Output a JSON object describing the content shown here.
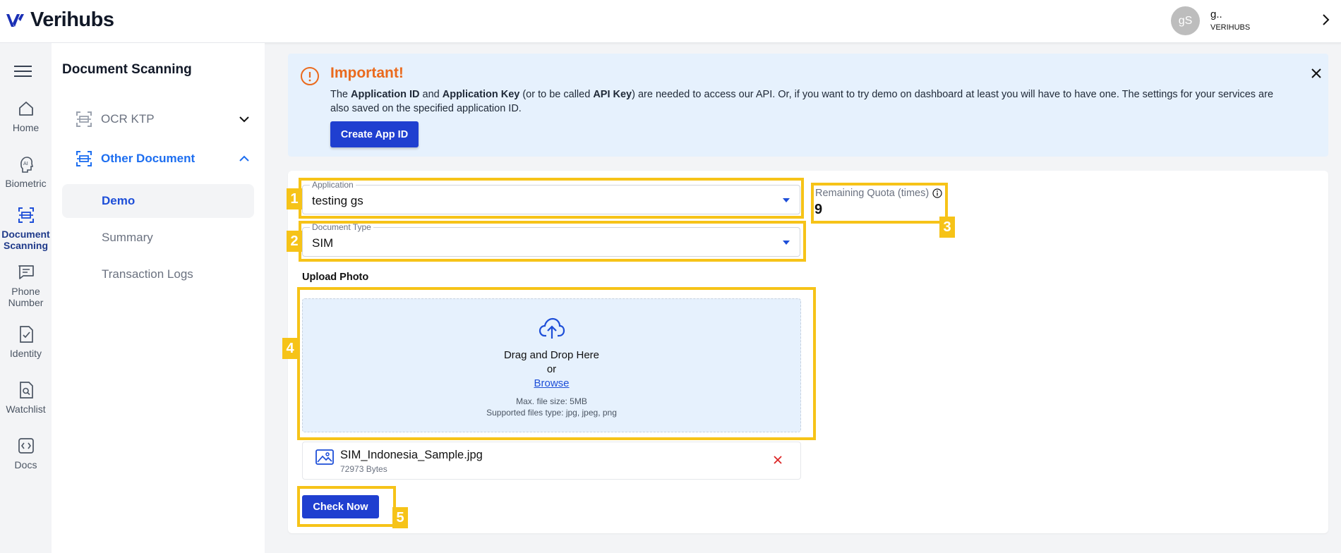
{
  "header": {
    "brand": "Verihubs",
    "user_initials": "gS",
    "user_name": "g..",
    "user_org": "VERIHUBS"
  },
  "rail": {
    "items": [
      {
        "label": "Home",
        "icon": "home-icon"
      },
      {
        "label": "Biometric",
        "icon": "ai-face-icon"
      },
      {
        "label": "Document Scanning",
        "icon": "scan-icon"
      },
      {
        "label": "Phone Number",
        "icon": "chat-icon"
      },
      {
        "label": "Identity",
        "icon": "document-check-icon"
      },
      {
        "label": "Watchlist",
        "icon": "document-search-icon"
      },
      {
        "label": "Docs",
        "icon": "code-icon"
      }
    ],
    "active": "Document Scanning"
  },
  "sidebar": {
    "title": "Document Scanning",
    "groups": [
      {
        "label": "OCR KTP",
        "expanded": false
      },
      {
        "label": "Other Document",
        "expanded": true
      }
    ],
    "sub_items": [
      "Demo",
      "Summary",
      "Transaction Logs"
    ],
    "active_sub": "Demo"
  },
  "alert": {
    "title": "Important!",
    "body_1": "The ",
    "bold_1": "Application ID",
    "body_2": " and ",
    "bold_2": "Application Key",
    "body_3": " (or to be called ",
    "bold_3": "API Key",
    "body_4": ") are needed to access our API. Or, if you want to try demo on dashboard at least you will have to have one. The settings for your services are also saved on the specified application ID.",
    "button": "Create App ID"
  },
  "form": {
    "application_label": "Application",
    "application_value": "testing gs",
    "document_type_label": "Document Type",
    "document_type_value": "SIM",
    "quota_label": "Remaining Quota (times)",
    "quota_value": "9",
    "upload_title": "Upload Photo",
    "dropzone": {
      "main": "Drag and Drop Here",
      "or": "or",
      "browse": "Browse",
      "max_size": "Max. file size: 5MB",
      "types": "Supported files type: jpg, jpeg, png"
    },
    "file": {
      "name": "SIM_Indonesia_Sample.jpg",
      "size": "72973 Bytes"
    },
    "submit": "Check Now"
  },
  "annotations": [
    "1",
    "2",
    "3",
    "4",
    "5"
  ],
  "colors": {
    "primary": "#1f3fd0",
    "link": "#1d4ed8",
    "alert_bg": "#e6f1fd",
    "alert_title": "#ea6a1d",
    "highlight": "#f6c318"
  }
}
